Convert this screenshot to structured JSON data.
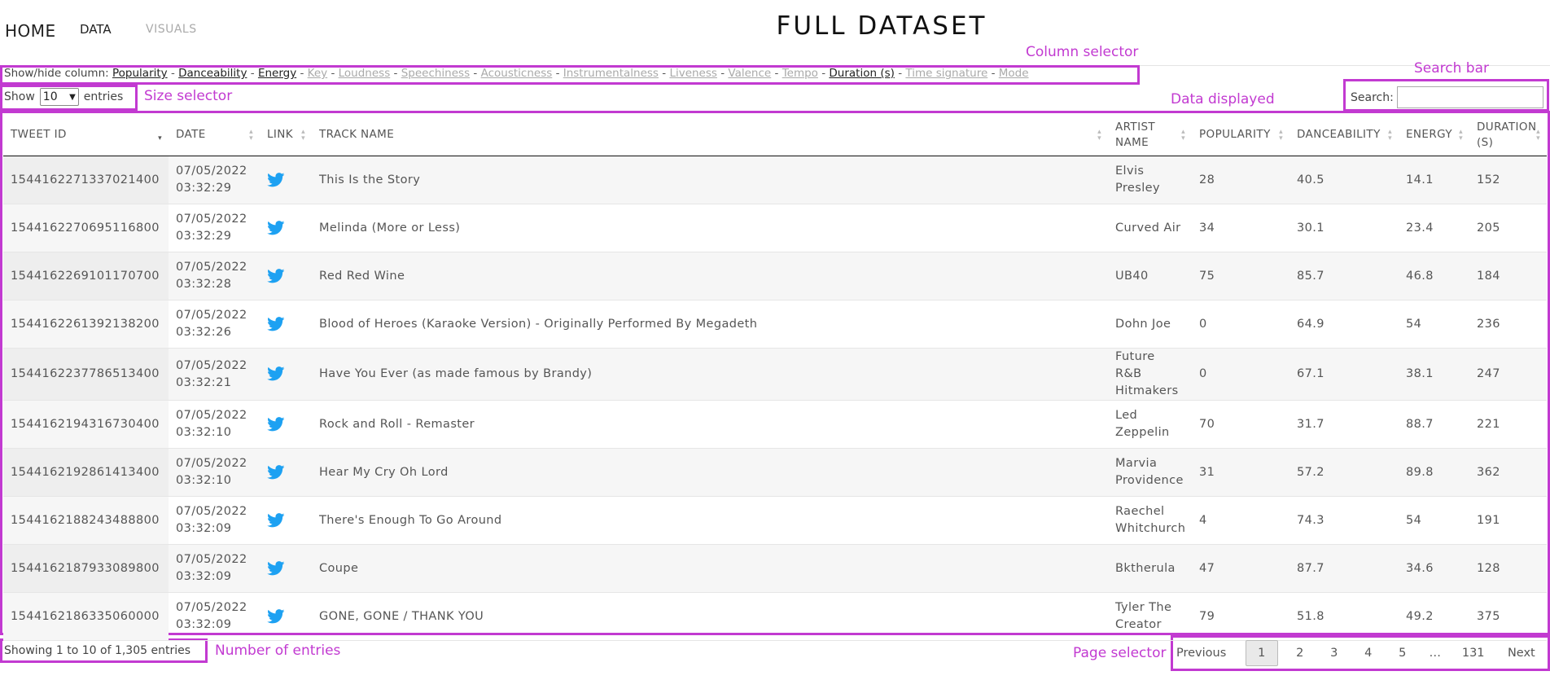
{
  "nav": {
    "home": "HOME",
    "data": "DATA",
    "visuals": "VISUALS"
  },
  "page_title": "FULL DATASET",
  "annotations": {
    "column_selector": "Column selector",
    "search_bar": "Search bar",
    "size_selector": "Size selector",
    "data_displayed": "Data displayed",
    "number_of_entries": "Number of entries",
    "page_selector": "Page selector"
  },
  "column_toggle": {
    "label": "Show/hide column:",
    "separator": "-",
    "items": [
      {
        "label": "Popularity",
        "active": true
      },
      {
        "label": "Danceability",
        "active": true
      },
      {
        "label": "Energy",
        "active": true
      },
      {
        "label": "Key",
        "active": false
      },
      {
        "label": "Loudness",
        "active": false
      },
      {
        "label": "Speechiness",
        "active": false
      },
      {
        "label": "Acousticness",
        "active": false
      },
      {
        "label": "Instrumentalness",
        "active": false
      },
      {
        "label": "Liveness",
        "active": false
      },
      {
        "label": "Valence",
        "active": false
      },
      {
        "label": "Tempo",
        "active": false
      },
      {
        "label": "Duration (s)",
        "active": true
      },
      {
        "label": "Time signature",
        "active": false
      },
      {
        "label": "Mode",
        "active": false
      }
    ]
  },
  "length_menu": {
    "show": "Show",
    "value": "10",
    "entries": "entries"
  },
  "search": {
    "label": "Search:",
    "value": ""
  },
  "table": {
    "columns": [
      {
        "line1": "TWEET ID",
        "line2": "",
        "sorted": true
      },
      {
        "line1": "DATE",
        "line2": "",
        "sorted": false
      },
      {
        "line1": "LINK",
        "line2": "",
        "sorted": false
      },
      {
        "line1": "TRACK NAME",
        "line2": "",
        "sorted": false
      },
      {
        "line1": "ARTIST",
        "line2": "NAME",
        "sorted": false
      },
      {
        "line1": "POPULARITY",
        "line2": "",
        "sorted": false
      },
      {
        "line1": "DANCEABILITY",
        "line2": "",
        "sorted": false
      },
      {
        "line1": "ENERGY",
        "line2": "",
        "sorted": false
      },
      {
        "line1": "DURATION",
        "line2": "(S)",
        "sorted": false
      }
    ],
    "rows": [
      {
        "tweet_id": "1544162271337021400",
        "date": "07/05/2022",
        "time": "03:32:29",
        "track": "This Is the Story",
        "artist_1": "Elvis",
        "artist_2": "Presley",
        "popularity": "28",
        "danceability": "40.5",
        "energy": "14.1",
        "duration": "152"
      },
      {
        "tweet_id": "1544162270695116800",
        "date": "07/05/2022",
        "time": "03:32:29",
        "track": "Melinda (More or Less)",
        "artist_1": "Curved Air",
        "artist_2": "",
        "popularity": "34",
        "danceability": "30.1",
        "energy": "23.4",
        "duration": "205"
      },
      {
        "tweet_id": "1544162269101170700",
        "date": "07/05/2022",
        "time": "03:32:28",
        "track": "Red Red Wine",
        "artist_1": "UB40",
        "artist_2": "",
        "popularity": "75",
        "danceability": "85.7",
        "energy": "46.8",
        "duration": "184"
      },
      {
        "tweet_id": "1544162261392138200",
        "date": "07/05/2022",
        "time": "03:32:26",
        "track": "Blood of Heroes (Karaoke Version) - Originally Performed By Megadeth",
        "artist_1": "Dohn Joe",
        "artist_2": "",
        "popularity": "0",
        "danceability": "64.9",
        "energy": "54",
        "duration": "236"
      },
      {
        "tweet_id": "1544162237786513400",
        "date": "07/05/2022",
        "time": "03:32:21",
        "track": "Have You Ever (as made famous by Brandy)",
        "artist_1": "Future R&B",
        "artist_2": "Hitmakers",
        "popularity": "0",
        "danceability": "67.1",
        "energy": "38.1",
        "duration": "247"
      },
      {
        "tweet_id": "1544162194316730400",
        "date": "07/05/2022",
        "time": "03:32:10",
        "track": "Rock and Roll - Remaster",
        "artist_1": "Led",
        "artist_2": "Zeppelin",
        "popularity": "70",
        "danceability": "31.7",
        "energy": "88.7",
        "duration": "221"
      },
      {
        "tweet_id": "1544162192861413400",
        "date": "07/05/2022",
        "time": "03:32:10",
        "track": "Hear My Cry Oh Lord",
        "artist_1": "Marvia",
        "artist_2": "Providence",
        "popularity": "31",
        "danceability": "57.2",
        "energy": "89.8",
        "duration": "362"
      },
      {
        "tweet_id": "1544162188243488800",
        "date": "07/05/2022",
        "time": "03:32:09",
        "track": "There's Enough To Go Around",
        "artist_1": "Raechel",
        "artist_2": "Whitchurch",
        "popularity": "4",
        "danceability": "74.3",
        "energy": "54",
        "duration": "191"
      },
      {
        "tweet_id": "1544162187933089800",
        "date": "07/05/2022",
        "time": "03:32:09",
        "track": "Coupe",
        "artist_1": "Bktherula",
        "artist_2": "",
        "popularity": "47",
        "danceability": "87.7",
        "energy": "34.6",
        "duration": "128"
      },
      {
        "tweet_id": "1544162186335060000",
        "date": "07/05/2022",
        "time": "03:32:09",
        "track": "GONE, GONE / THANK YOU",
        "artist_1": "Tyler The",
        "artist_2": "Creator",
        "popularity": "79",
        "danceability": "51.8",
        "energy": "49.2",
        "duration": "375"
      }
    ]
  },
  "info": "Showing 1 to 10 of 1,305 entries",
  "pagination": {
    "previous": "Previous",
    "pages": [
      "1",
      "2",
      "3",
      "4",
      "5",
      "…",
      "131"
    ],
    "current": "1",
    "next": "Next"
  },
  "colors": {
    "annotation": "#c23ad1",
    "twitter": "#1da1f2",
    "active_link": "#222222",
    "inactive_link": "#aaaaaa"
  },
  "icons": {
    "link": "twitter-bird-icon"
  }
}
